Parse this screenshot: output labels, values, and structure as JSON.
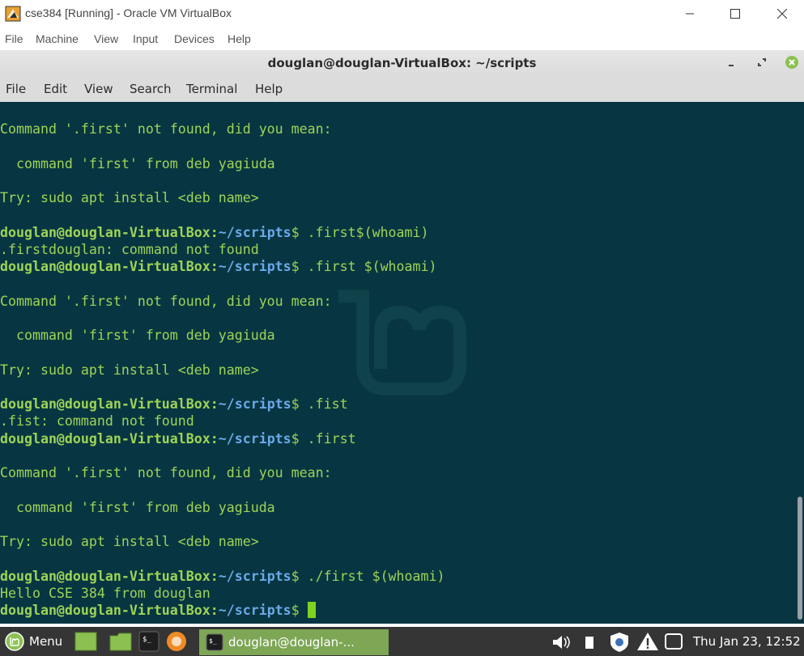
{
  "vbox": {
    "title": "cse384 [Running] - Oracle VM VirtualBox",
    "menu": [
      "File",
      "Machine",
      "View",
      "Input",
      "Devices",
      "Help"
    ]
  },
  "terminal_window": {
    "title": "douglan@douglan-VirtualBox: ~/scripts",
    "menu": [
      "File",
      "Edit",
      "View",
      "Search",
      "Terminal",
      "Help"
    ]
  },
  "terminal": {
    "prompt_user": "douglan@douglan-VirtualBox",
    "prompt_colon": ":",
    "prompt_path": "~/scripts",
    "prompt_symbol": "$ ",
    "lines": [
      "Command '.first' not found, did you mean:",
      "",
      "  command 'first' from deb yagiuda",
      "",
      "Try: sudo apt install <deb name>",
      "",
      "",
      ".firstdouglan: command not found",
      "",
      "",
      "Command '.first' not found, did you mean:",
      "",
      "  command 'first' from deb yagiuda",
      "",
      "Try: sudo apt install <deb name>",
      "",
      "",
      ".fist: command not found",
      "",
      "",
      "Command '.first' not found, did you mean:",
      "",
      "  command 'first' from deb yagiuda",
      "",
      "Try: sudo apt install <deb name>",
      "",
      "",
      "Hello CSE 384 from douglan",
      ""
    ],
    "commands": [
      ".first$(whoami)",
      ".first $(whoami)",
      ".fist",
      ".first",
      "./first $(whoami)",
      ""
    ]
  },
  "taskbar": {
    "menu_label": "Menu",
    "active_window_label": "douglan@douglan-...",
    "clock": "Thu Jan 23, 12:52"
  },
  "colors": {
    "terminal_bg": "#073642",
    "terminal_fg": "#9fd356",
    "prompt_path": "#6aa9e8",
    "taskbar_bg": "#353535",
    "active_task": "#7da655"
  }
}
